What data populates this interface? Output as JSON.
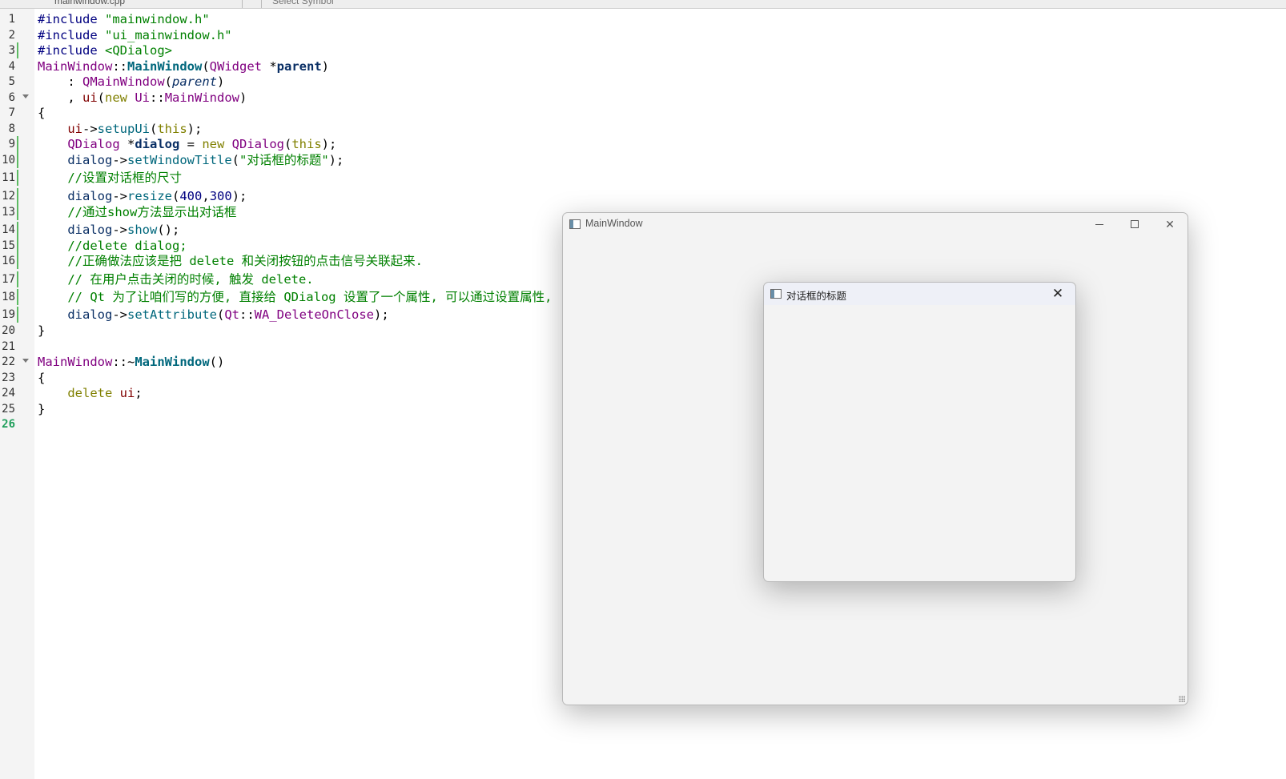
{
  "toolbar": {
    "file_label": "mainwindow.cpp",
    "symbol_placeholder": "Select Symbol"
  },
  "editor": {
    "current_line": 26,
    "line_numbers": [
      "1",
      "2",
      "3",
      "4",
      "5",
      "6",
      "7",
      "8",
      "9",
      "10",
      "11",
      "12",
      "13",
      "14",
      "15",
      "16",
      "17",
      "18",
      "19",
      "20",
      "21",
      "22",
      "23",
      "24",
      "25",
      "26"
    ],
    "lines": [
      [
        [
          "pre",
          "#include "
        ],
        [
          "str",
          "\"mainwindow.h\""
        ]
      ],
      [
        [
          "pre",
          "#include "
        ],
        [
          "str",
          "\"ui_mainwindow.h\""
        ]
      ],
      [
        [
          "pre",
          "#include "
        ],
        [
          "str",
          "<QDialog>"
        ]
      ],
      [
        [
          "cls",
          "MainWindow"
        ],
        [
          "",
          "::"
        ],
        [
          "fnd",
          "MainWindow"
        ],
        [
          "",
          "("
        ],
        [
          "cls",
          "QWidget"
        ],
        [
          "",
          " *"
        ],
        [
          "varb",
          "parent"
        ],
        [
          "",
          ")"
        ]
      ],
      [
        [
          "",
          "    : "
        ],
        [
          "cls",
          "QMainWindow"
        ],
        [
          "",
          "("
        ],
        [
          "par",
          "parent"
        ],
        [
          "",
          ")"
        ]
      ],
      [
        [
          "",
          "    , "
        ],
        [
          "mem",
          "ui"
        ],
        [
          "",
          "("
        ],
        [
          "kw",
          "new "
        ],
        [
          "en",
          "Ui"
        ],
        [
          "",
          "::"
        ],
        [
          "cls",
          "MainWindow"
        ],
        [
          "",
          ")"
        ]
      ],
      [
        [
          "",
          "{"
        ]
      ],
      [
        [
          "",
          "    "
        ],
        [
          "mem",
          "ui"
        ],
        [
          "",
          "->"
        ],
        [
          "fn",
          "setupUi"
        ],
        [
          "",
          "("
        ],
        [
          "kw",
          "this"
        ],
        [
          "",
          ");"
        ]
      ],
      [
        [
          "",
          "    "
        ],
        [
          "cls",
          "QDialog"
        ],
        [
          "",
          " *"
        ],
        [
          "varb",
          "dialog"
        ],
        [
          "",
          " = "
        ],
        [
          "kw",
          "new "
        ],
        [
          "cls",
          "QDialog"
        ],
        [
          "",
          "("
        ],
        [
          "kw",
          "this"
        ],
        [
          "",
          ");"
        ]
      ],
      [
        [
          "",
          "    "
        ],
        [
          "var",
          "dialog"
        ],
        [
          "",
          "->"
        ],
        [
          "fn",
          "setWindowTitle"
        ],
        [
          "",
          "("
        ],
        [
          "str",
          "\"对话框的标题\""
        ],
        [
          "",
          ");"
        ]
      ],
      [
        [
          "",
          "    "
        ],
        [
          "cmt",
          "//设置对话框的尺寸"
        ]
      ],
      [
        [
          "",
          "    "
        ],
        [
          "var",
          "dialog"
        ],
        [
          "",
          "->"
        ],
        [
          "fn",
          "resize"
        ],
        [
          "",
          "("
        ],
        [
          "num",
          "400"
        ],
        [
          "",
          ","
        ],
        [
          "num",
          "300"
        ],
        [
          "",
          ");"
        ]
      ],
      [
        [
          "",
          "    "
        ],
        [
          "cmt",
          "//通过show方法显示出对话框"
        ]
      ],
      [
        [
          "",
          "    "
        ],
        [
          "var",
          "dialog"
        ],
        [
          "",
          "->"
        ],
        [
          "fn",
          "show"
        ],
        [
          "",
          "();"
        ]
      ],
      [
        [
          "",
          "    "
        ],
        [
          "cmt",
          "//delete dialog;"
        ]
      ],
      [
        [
          "",
          "    "
        ],
        [
          "cmt",
          "//正确做法应该是把 delete 和关闭按钮的点击信号关联起来."
        ]
      ],
      [
        [
          "",
          "    "
        ],
        [
          "cmt",
          "// 在用户点击关闭的时候, 触发 delete."
        ]
      ],
      [
        [
          "",
          "    "
        ],
        [
          "cmt",
          "// Qt 为了让咱们写的方便, 直接给 QDialog 设置了一个属性, 可以通过设置属性,"
        ]
      ],
      [
        [
          "",
          "    "
        ],
        [
          "var",
          "dialog"
        ],
        [
          "",
          "->"
        ],
        [
          "fn",
          "setAttribute"
        ],
        [
          "",
          "("
        ],
        [
          "en",
          "Qt"
        ],
        [
          "",
          "::"
        ],
        [
          "en",
          "WA_DeleteOnClose"
        ],
        [
          "",
          ");"
        ]
      ],
      [
        [
          "",
          "}"
        ]
      ],
      [],
      [
        [
          "cls",
          "MainWindow"
        ],
        [
          "",
          "::~"
        ],
        [
          "fnd",
          "MainWindow"
        ],
        [
          "",
          "()"
        ]
      ],
      [
        [
          "",
          "{"
        ]
      ],
      [
        [
          "",
          "    "
        ],
        [
          "kw",
          "delete "
        ],
        [
          "mem",
          "ui"
        ],
        [
          "",
          ";"
        ]
      ],
      [
        [
          "",
          "}"
        ]
      ],
      []
    ]
  },
  "main_window": {
    "title": "MainWindow",
    "close_glyph": "✕"
  },
  "dialog": {
    "title": "对话框的标题",
    "close_glyph": "✕"
  }
}
